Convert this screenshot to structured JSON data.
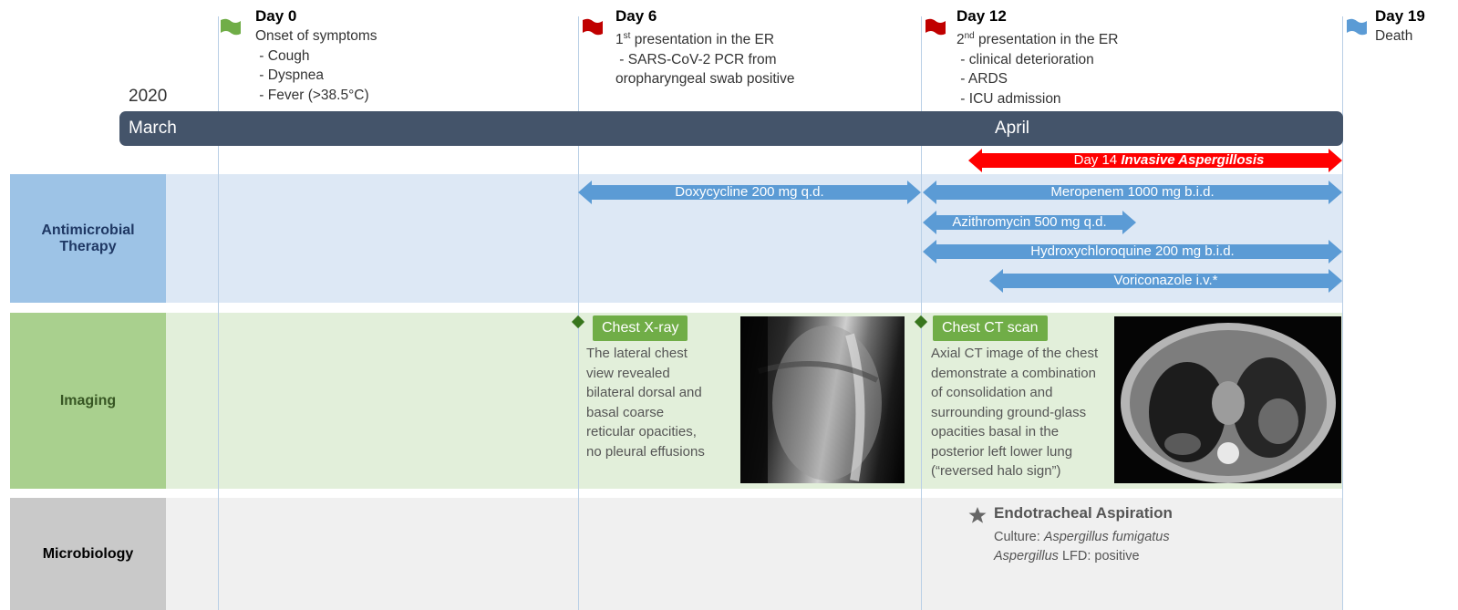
{
  "year": "2020",
  "months": [
    "March",
    "April"
  ],
  "events": [
    {
      "day": "Day 0",
      "lines": [
        "Onset of symptoms",
        " - Cough",
        " - Dyspnea",
        " - Fever (>38.5°C)"
      ],
      "flag_color": "#70ad47"
    },
    {
      "day": "Day 6",
      "line1_pre": "1",
      "line1_sup": "st",
      "line1_post": " presentation in the ER",
      "lines": [
        " - SARS-CoV-2 PCR from",
        "oropharyngeal swab positive"
      ],
      "flag_color": "#c00000"
    },
    {
      "day": "Day 12",
      "line1_pre": "2",
      "line1_sup": "nd",
      "line1_post": " presentation in the ER",
      "lines": [
        " - clinical deterioration",
        " - ARDS",
        " - ICU admission"
      ],
      "flag_color": "#c00000"
    },
    {
      "day": "Day 19",
      "lines": [
        "Death"
      ],
      "flag_color": "#5b9bd5"
    }
  ],
  "aspergillosis": {
    "prefix": "Day 14 ",
    "emph": "Invasive Aspergillosis",
    "color": "#ff0000"
  },
  "rows": {
    "antimicrobial": {
      "label_line1": "Antimicrobial",
      "label_line2": "Therapy"
    },
    "imaging": {
      "label": "Imaging"
    },
    "microbiology": {
      "label": "Microbiology"
    }
  },
  "therapies": [
    {
      "name": "Doxycycline 200 mg q.d."
    },
    {
      "name": "Meropenem 1000 mg b.i.d."
    },
    {
      "name": "Azithromycin 500 mg q.d."
    },
    {
      "name": "Hydroxychloroquine 200 mg b.i.d."
    },
    {
      "name": "Voriconazole i.v.*"
    }
  ],
  "imaging": {
    "xray": {
      "label": "Chest X-ray",
      "lines": [
        "The lateral chest",
        "view revealed",
        "bilateral dorsal and",
        "basal coarse",
        "reticular opacities,",
        "no pleural effusions"
      ]
    },
    "ct": {
      "label": "Chest CT scan",
      "lines": [
        "Axial CT image of the chest",
        "demonstrate a combination",
        "of consolidation and",
        "surrounding ground-glass",
        "opacities basal in the",
        "posterior left lower lung",
        "(“reversed halo sign”)"
      ]
    }
  },
  "microbiology": {
    "title": "Endotracheal Aspiration",
    "culture_prefix": "Culture: ",
    "culture_value": "Aspergillus fumigatus",
    "lfd_prefix": "Aspergillus",
    "lfd_suffix": " LFD: positive"
  },
  "colors": {
    "timeline": "#44546a",
    "arrow": "#5b9bd5",
    "antimicrobial_band": "#dde8f5",
    "antimicrobial_label": "#9dc3e6",
    "imaging_band": "#e2efda",
    "imaging_label": "#a9d08e",
    "micro_band": "#f0f0f0",
    "micro_label": "#c9c9c9"
  }
}
